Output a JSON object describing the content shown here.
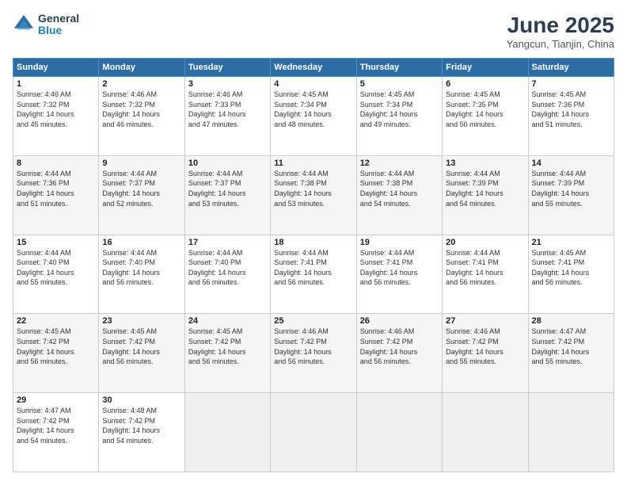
{
  "header": {
    "logo_general": "General",
    "logo_blue": "Blue",
    "month_title": "June 2025",
    "location": "Yangcun, Tianjin, China"
  },
  "weekdays": [
    "Sunday",
    "Monday",
    "Tuesday",
    "Wednesday",
    "Thursday",
    "Friday",
    "Saturday"
  ],
  "rows": [
    [
      {
        "day": "1",
        "info": "Sunrise: 4:46 AM\nSunset: 7:32 PM\nDaylight: 14 hours\nand 45 minutes."
      },
      {
        "day": "2",
        "info": "Sunrise: 4:46 AM\nSunset: 7:32 PM\nDaylight: 14 hours\nand 46 minutes."
      },
      {
        "day": "3",
        "info": "Sunrise: 4:46 AM\nSunset: 7:33 PM\nDaylight: 14 hours\nand 47 minutes."
      },
      {
        "day": "4",
        "info": "Sunrise: 4:45 AM\nSunset: 7:34 PM\nDaylight: 14 hours\nand 48 minutes."
      },
      {
        "day": "5",
        "info": "Sunrise: 4:45 AM\nSunset: 7:34 PM\nDaylight: 14 hours\nand 49 minutes."
      },
      {
        "day": "6",
        "info": "Sunrise: 4:45 AM\nSunset: 7:35 PM\nDaylight: 14 hours\nand 50 minutes."
      },
      {
        "day": "7",
        "info": "Sunrise: 4:45 AM\nSunset: 7:36 PM\nDaylight: 14 hours\nand 51 minutes."
      }
    ],
    [
      {
        "day": "8",
        "info": "Sunrise: 4:44 AM\nSunset: 7:36 PM\nDaylight: 14 hours\nand 51 minutes."
      },
      {
        "day": "9",
        "info": "Sunrise: 4:44 AM\nSunset: 7:37 PM\nDaylight: 14 hours\nand 52 minutes."
      },
      {
        "day": "10",
        "info": "Sunrise: 4:44 AM\nSunset: 7:37 PM\nDaylight: 14 hours\nand 53 minutes."
      },
      {
        "day": "11",
        "info": "Sunrise: 4:44 AM\nSunset: 7:38 PM\nDaylight: 14 hours\nand 53 minutes."
      },
      {
        "day": "12",
        "info": "Sunrise: 4:44 AM\nSunset: 7:38 PM\nDaylight: 14 hours\nand 54 minutes."
      },
      {
        "day": "13",
        "info": "Sunrise: 4:44 AM\nSunset: 7:39 PM\nDaylight: 14 hours\nand 54 minutes."
      },
      {
        "day": "14",
        "info": "Sunrise: 4:44 AM\nSunset: 7:39 PM\nDaylight: 14 hours\nand 55 minutes."
      }
    ],
    [
      {
        "day": "15",
        "info": "Sunrise: 4:44 AM\nSunset: 7:40 PM\nDaylight: 14 hours\nand 55 minutes."
      },
      {
        "day": "16",
        "info": "Sunrise: 4:44 AM\nSunset: 7:40 PM\nDaylight: 14 hours\nand 56 minutes."
      },
      {
        "day": "17",
        "info": "Sunrise: 4:44 AM\nSunset: 7:40 PM\nDaylight: 14 hours\nand 56 minutes."
      },
      {
        "day": "18",
        "info": "Sunrise: 4:44 AM\nSunset: 7:41 PM\nDaylight: 14 hours\nand 56 minutes."
      },
      {
        "day": "19",
        "info": "Sunrise: 4:44 AM\nSunset: 7:41 PM\nDaylight: 14 hours\nand 56 minutes."
      },
      {
        "day": "20",
        "info": "Sunrise: 4:44 AM\nSunset: 7:41 PM\nDaylight: 14 hours\nand 56 minutes."
      },
      {
        "day": "21",
        "info": "Sunrise: 4:45 AM\nSunset: 7:41 PM\nDaylight: 14 hours\nand 56 minutes."
      }
    ],
    [
      {
        "day": "22",
        "info": "Sunrise: 4:45 AM\nSunset: 7:42 PM\nDaylight: 14 hours\nand 56 minutes."
      },
      {
        "day": "23",
        "info": "Sunrise: 4:45 AM\nSunset: 7:42 PM\nDaylight: 14 hours\nand 56 minutes."
      },
      {
        "day": "24",
        "info": "Sunrise: 4:45 AM\nSunset: 7:42 PM\nDaylight: 14 hours\nand 56 minutes."
      },
      {
        "day": "25",
        "info": "Sunrise: 4:46 AM\nSunset: 7:42 PM\nDaylight: 14 hours\nand 56 minutes."
      },
      {
        "day": "26",
        "info": "Sunrise: 4:46 AM\nSunset: 7:42 PM\nDaylight: 14 hours\nand 56 minutes."
      },
      {
        "day": "27",
        "info": "Sunrise: 4:46 AM\nSunset: 7:42 PM\nDaylight: 14 hours\nand 55 minutes."
      },
      {
        "day": "28",
        "info": "Sunrise: 4:47 AM\nSunset: 7:42 PM\nDaylight: 14 hours\nand 55 minutes."
      }
    ],
    [
      {
        "day": "29",
        "info": "Sunrise: 4:47 AM\nSunset: 7:42 PM\nDaylight: 14 hours\nand 54 minutes."
      },
      {
        "day": "30",
        "info": "Sunrise: 4:48 AM\nSunset: 7:42 PM\nDaylight: 14 hours\nand 54 minutes."
      },
      {
        "day": "",
        "info": ""
      },
      {
        "day": "",
        "info": ""
      },
      {
        "day": "",
        "info": ""
      },
      {
        "day": "",
        "info": ""
      },
      {
        "day": "",
        "info": ""
      }
    ]
  ]
}
